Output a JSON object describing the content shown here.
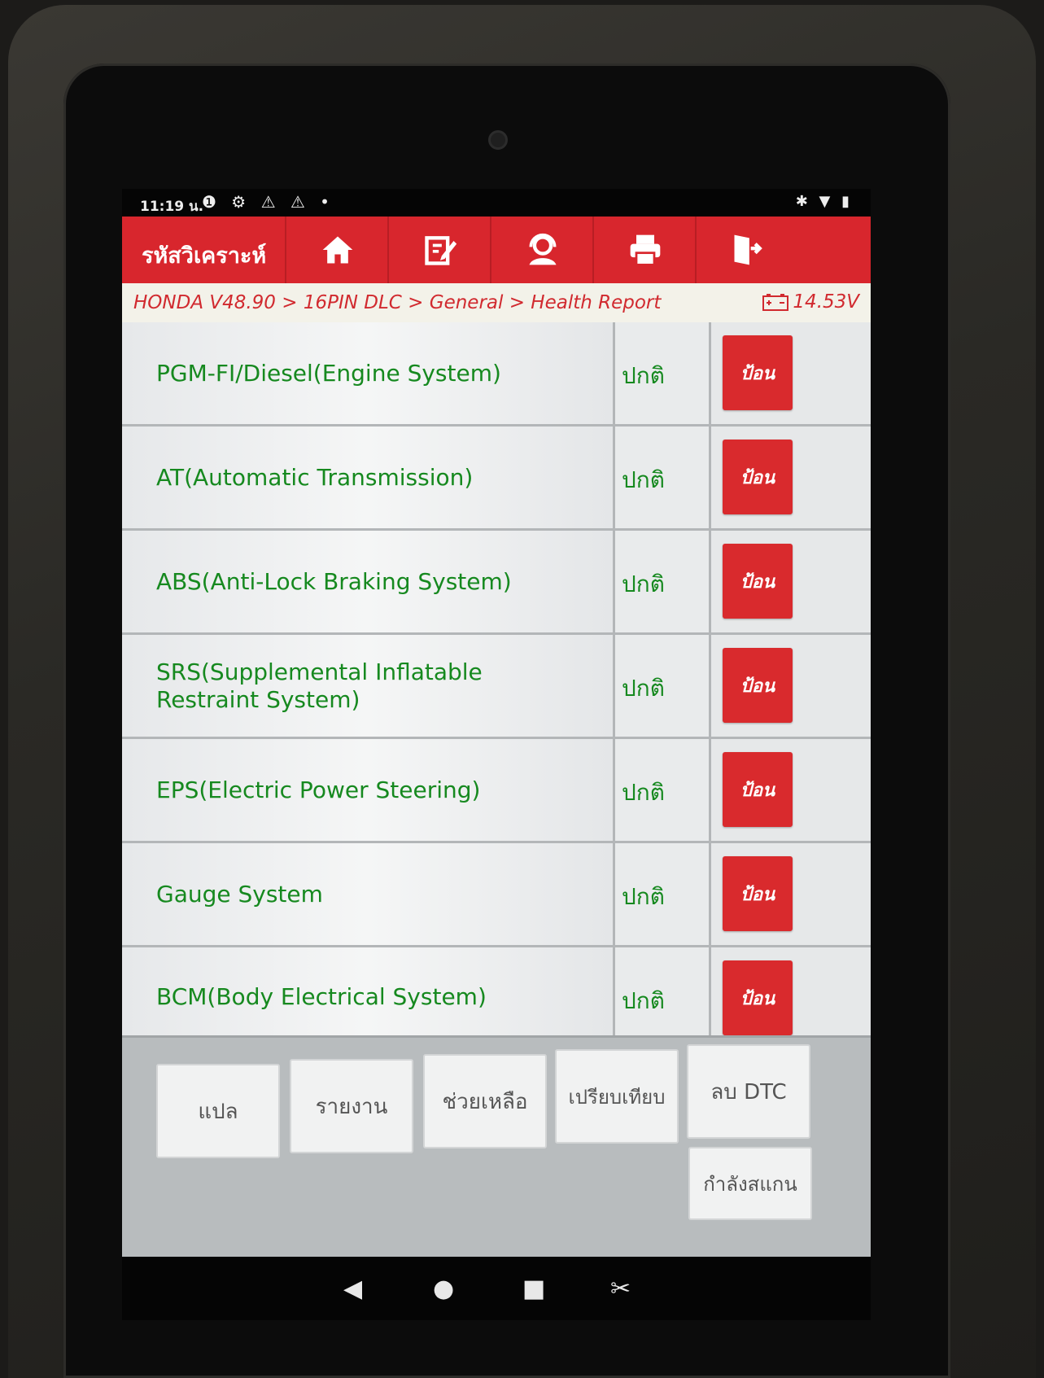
{
  "status_bar": {
    "time": "11:19 น.",
    "left_icons": "❶ ⚙ ⚠ ⚠ •",
    "right_icons": "✱ ▼ ▮"
  },
  "header": {
    "title": "รหัสวิเคราะห์",
    "buttons": [
      "home-icon",
      "edit-report-icon",
      "support-icon",
      "print-icon",
      "exit-icon"
    ]
  },
  "breadcrumb": {
    "path": "HONDA V48.90 > 16PIN DLC > General > Health Report",
    "voltage": "14.53V"
  },
  "systems": [
    {
      "name": "PGM-FI/Diesel(Engine System)",
      "status": "ปกติ",
      "action": "ป้อน"
    },
    {
      "name": "AT(Automatic Transmission)",
      "status": "ปกติ",
      "action": "ป้อน"
    },
    {
      "name": "ABS(Anti-Lock Braking System)",
      "status": "ปกติ",
      "action": "ป้อน"
    },
    {
      "name": "SRS(Supplemental Inflatable Restraint System)",
      "status": "ปกติ",
      "action": "ป้อน"
    },
    {
      "name": "EPS(Electric Power Steering)",
      "status": "ปกติ",
      "action": "ป้อน"
    },
    {
      "name": "Gauge System",
      "status": "ปกติ",
      "action": "ป้อน"
    },
    {
      "name": "BCM(Body Electrical System)",
      "status": "ปกติ",
      "action": "ป้อน"
    }
  ],
  "toolbar": {
    "translate": "แปล",
    "report": "รายงาน",
    "help": "ช่วยเหลือ",
    "compare": "เปรียบเทียบ",
    "clear_dtc": "ลบ DTC",
    "scanning": "กำลังสแกน"
  },
  "nav": {
    "back": "◀",
    "home": "●",
    "recents": "■",
    "screenshot": "✂"
  }
}
